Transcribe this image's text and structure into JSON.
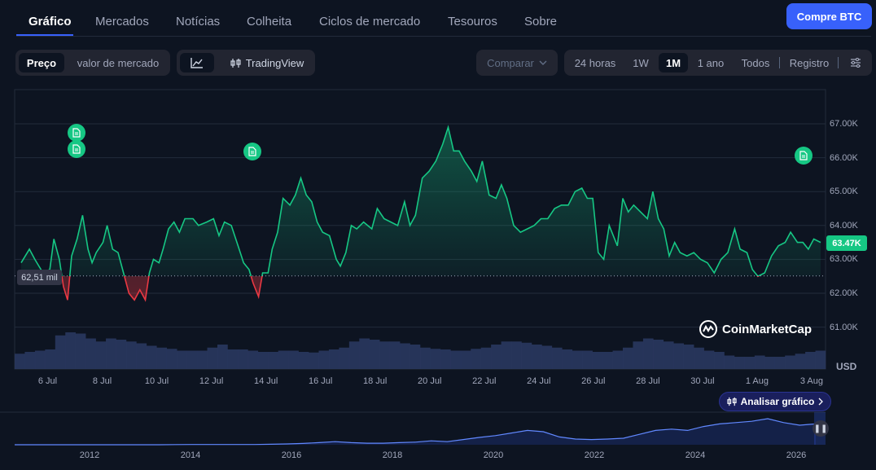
{
  "nav": {
    "tabs": [
      "Gráfico",
      "Mercados",
      "Notícias",
      "Colheita",
      "Ciclos de mercado",
      "Tesouros",
      "Sobre"
    ],
    "buy_button": "Compre BTC"
  },
  "toolbar": {
    "metric": [
      "Preço",
      "valor de mercado"
    ],
    "chart_mode": [
      "line-chart-icon",
      "TradingView"
    ],
    "compare": "Comparar",
    "ranges": [
      "24 horas",
      "1W",
      "1M",
      "1 ano",
      "Todos"
    ],
    "log": "Registro",
    "active_metric": "Preço",
    "active_range": "1M"
  },
  "chart": {
    "current_price_label": "63.47K",
    "start_price_label": "62,51 mil",
    "currency": "USD",
    "brand": "CoinMarketCap",
    "analyze_button": "Analisar gráfico"
  },
  "chart_data": {
    "type": "area",
    "x_tick_labels": [
      "6 Jul",
      "8 Jul",
      "10 Jul",
      "12 Jul",
      "14 Jul",
      "16 Jul",
      "18 Jul",
      "20 Jul",
      "22 Jul",
      "24 Jul",
      "26 Jul",
      "28 Jul",
      "30 Jul",
      "1 Aug",
      "3 Aug"
    ],
    "y_tick_labels": [
      "67.00K",
      "66.00K",
      "65.00K",
      "64.00K",
      "63.00K",
      "62.00K",
      "61.00K"
    ],
    "ylim": [
      60500,
      67300
    ],
    "baseline": 62510,
    "series": [
      {
        "points": [
          [
            0,
            62.9
          ],
          [
            0.3,
            63.3
          ],
          [
            0.5,
            63.0
          ],
          [
            0.8,
            62.6
          ],
          [
            1.05,
            62.7
          ],
          [
            1.2,
            63.6
          ],
          [
            1.4,
            63.0
          ],
          [
            1.55,
            62.2
          ],
          [
            1.7,
            61.8
          ],
          [
            1.85,
            63.1
          ],
          [
            2.05,
            63.6
          ],
          [
            2.25,
            64.3
          ],
          [
            2.45,
            63.3
          ],
          [
            2.6,
            62.9
          ],
          [
            2.75,
            63.2
          ],
          [
            3.0,
            63.5
          ],
          [
            3.15,
            64.0
          ],
          [
            3.35,
            63.3
          ],
          [
            3.55,
            63.2
          ],
          [
            3.75,
            62.6
          ],
          [
            3.95,
            62.0
          ],
          [
            4.15,
            61.8
          ],
          [
            4.35,
            62.1
          ],
          [
            4.55,
            61.8
          ],
          [
            4.7,
            62.6
          ],
          [
            4.85,
            63.0
          ],
          [
            5.05,
            62.9
          ],
          [
            5.2,
            63.3
          ],
          [
            5.4,
            63.9
          ],
          [
            5.6,
            64.1
          ],
          [
            5.8,
            63.8
          ],
          [
            6.0,
            64.2
          ],
          [
            6.3,
            64.2
          ],
          [
            6.5,
            64.0
          ],
          [
            6.8,
            64.1
          ],
          [
            7.05,
            64.2
          ],
          [
            7.25,
            63.7
          ],
          [
            7.45,
            64.1
          ],
          [
            7.7,
            64.0
          ],
          [
            7.95,
            63.4
          ],
          [
            8.15,
            62.9
          ],
          [
            8.35,
            62.7
          ],
          [
            8.5,
            62.3
          ],
          [
            8.7,
            61.9
          ],
          [
            8.85,
            62.6
          ],
          [
            9.05,
            62.6
          ],
          [
            9.2,
            63.3
          ],
          [
            9.4,
            63.8
          ],
          [
            9.6,
            64.8
          ],
          [
            9.85,
            64.6
          ],
          [
            10.05,
            64.9
          ],
          [
            10.25,
            65.4
          ],
          [
            10.45,
            64.9
          ],
          [
            10.65,
            64.7
          ],
          [
            10.85,
            64.1
          ],
          [
            11.05,
            63.8
          ],
          [
            11.3,
            63.7
          ],
          [
            11.55,
            63.0
          ],
          [
            11.7,
            62.8
          ],
          [
            11.9,
            63.2
          ],
          [
            12.1,
            64.0
          ],
          [
            12.3,
            63.9
          ],
          [
            12.55,
            64.1
          ],
          [
            12.85,
            63.9
          ],
          [
            13.05,
            64.5
          ],
          [
            13.3,
            64.2
          ],
          [
            13.55,
            64.1
          ],
          [
            13.8,
            64.0
          ],
          [
            14.05,
            64.7
          ],
          [
            14.25,
            64.0
          ],
          [
            14.45,
            64.3
          ],
          [
            14.7,
            65.4
          ],
          [
            14.95,
            65.6
          ],
          [
            15.2,
            65.9
          ],
          [
            15.45,
            66.4
          ],
          [
            15.65,
            66.9
          ],
          [
            15.85,
            66.2
          ],
          [
            16.05,
            66.2
          ],
          [
            16.25,
            65.9
          ],
          [
            16.5,
            65.6
          ],
          [
            16.7,
            65.3
          ],
          [
            16.9,
            65.9
          ],
          [
            17.15,
            64.9
          ],
          [
            17.4,
            64.8
          ],
          [
            17.6,
            65.2
          ],
          [
            17.8,
            64.8
          ],
          [
            18.05,
            64.0
          ],
          [
            18.3,
            63.8
          ],
          [
            18.55,
            63.9
          ],
          [
            18.8,
            64.0
          ],
          [
            19.05,
            64.2
          ],
          [
            19.3,
            64.2
          ],
          [
            19.55,
            64.5
          ],
          [
            19.8,
            64.6
          ],
          [
            20.05,
            64.6
          ],
          [
            20.3,
            65.0
          ],
          [
            20.55,
            65.1
          ],
          [
            20.75,
            64.8
          ],
          [
            20.95,
            64.8
          ],
          [
            21.15,
            63.2
          ],
          [
            21.35,
            63.0
          ],
          [
            21.55,
            64.0
          ],
          [
            21.85,
            63.4
          ],
          [
            22.05,
            64.8
          ],
          [
            22.25,
            64.4
          ],
          [
            22.45,
            64.6
          ],
          [
            22.7,
            64.4
          ],
          [
            22.95,
            64.2
          ],
          [
            23.15,
            65.0
          ],
          [
            23.35,
            64.2
          ],
          [
            23.55,
            63.9
          ],
          [
            23.75,
            63.1
          ],
          [
            23.95,
            63.5
          ],
          [
            24.15,
            63.2
          ],
          [
            24.4,
            63.1
          ],
          [
            24.65,
            63.2
          ],
          [
            24.9,
            63.0
          ],
          [
            25.15,
            62.9
          ],
          [
            25.4,
            62.6
          ],
          [
            25.65,
            63.0
          ],
          [
            25.9,
            63.2
          ],
          [
            26.15,
            63.9
          ],
          [
            26.35,
            63.3
          ],
          [
            26.6,
            63.2
          ],
          [
            26.8,
            62.7
          ],
          [
            27.0,
            62.5
          ],
          [
            27.25,
            62.6
          ],
          [
            27.5,
            63.1
          ],
          [
            27.75,
            63.4
          ],
          [
            28.0,
            63.5
          ],
          [
            28.2,
            63.8
          ],
          [
            28.45,
            63.5
          ],
          [
            28.65,
            63.5
          ],
          [
            28.85,
            63.3
          ],
          [
            29.05,
            63.6
          ],
          [
            29.3,
            63.5
          ]
        ]
      }
    ],
    "volume_shape": [
      0.25,
      0.28,
      0.3,
      0.32,
      0.55,
      0.6,
      0.58,
      0.5,
      0.45,
      0.5,
      0.48,
      0.45,
      0.42,
      0.38,
      0.35,
      0.33,
      0.3,
      0.3,
      0.3,
      0.35,
      0.4,
      0.32,
      0.32,
      0.3,
      0.28,
      0.28,
      0.3,
      0.3,
      0.28,
      0.27,
      0.3,
      0.32,
      0.35,
      0.45,
      0.5,
      0.48,
      0.45,
      0.45,
      0.42,
      0.4,
      0.35,
      0.33,
      0.32,
      0.3,
      0.3,
      0.33,
      0.35,
      0.4,
      0.45,
      0.45,
      0.43,
      0.4,
      0.38,
      0.35,
      0.32,
      0.3,
      0.3,
      0.28,
      0.28,
      0.3,
      0.35,
      0.45,
      0.5,
      0.48,
      0.45,
      0.42,
      0.4,
      0.35,
      0.3,
      0.28,
      0.22,
      0.2,
      0.2,
      0.22,
      0.2,
      0.2,
      0.22,
      0.25,
      0.28,
      0.3
    ],
    "mini_x_labels": [
      "2012",
      "2014",
      "2016",
      "2018",
      "2020",
      "2022",
      "2024",
      "2026"
    ],
    "mini_shape": [
      0,
      0,
      0,
      0,
      0,
      0,
      0,
      0,
      0,
      0,
      0.005,
      0.01,
      0.01,
      0.01,
      0.01,
      0.01,
      0.02,
      0.03,
      0.05,
      0.08,
      0.12,
      0.08,
      0.06,
      0.06,
      0.08,
      0.1,
      0.15,
      0.12,
      0.2,
      0.28,
      0.35,
      0.45,
      0.55,
      0.5,
      0.3,
      0.22,
      0.2,
      0.22,
      0.25,
      0.4,
      0.55,
      0.6,
      0.55,
      0.7,
      0.8,
      0.85,
      0.9,
      1.0,
      0.85,
      0.75,
      0.8
    ]
  }
}
